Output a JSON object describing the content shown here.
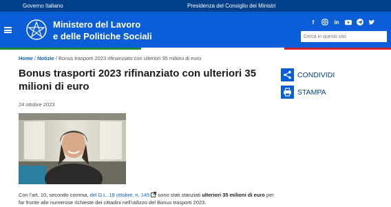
{
  "topbar": {
    "left_link": "Governo Italiano",
    "center_link": "Presidenza del Consiglio dei Ministri"
  },
  "header": {
    "brand_line1": "Ministero del Lavoro",
    "brand_line2": "e delle Politiche Sociali",
    "search_placeholder": "Cerca in questo sito",
    "social": [
      "facebook-icon",
      "instagram-icon",
      "linkedin-icon",
      "youtube-icon",
      "telegram-icon",
      "twitter-icon"
    ]
  },
  "breadcrumb": {
    "home": "Home",
    "sep1": " / ",
    "section": "Notizie",
    "sep2": " / ",
    "current": "Bonus trasporti 2023 rifinanziato con ulteriori 35 milioni di euro"
  },
  "article": {
    "title": "Bonus trasporti 2023 rifinanziato con ulteriori 35 milioni di euro",
    "date": "24 ottobre 2023",
    "p1_a": "Con l'art. 10, secondo comma, ",
    "p1_link": "del D.L. 18 ottobre, n. 145",
    "p1_b": " sono stati stanziati ",
    "p1_bold": "ulteriori 35 milioni di euro",
    "p1_c": " per far fronte alle numerose richieste dei cittadini nell'utilizzo del Bonus trasporti 2023."
  },
  "actions": {
    "share": "CONDIVIDI",
    "print": "STAMPA"
  },
  "colors": {
    "topbar": "#003f8a",
    "header": "#0b5ed7",
    "green": "#1f8a3a",
    "red": "#d21f2a"
  }
}
